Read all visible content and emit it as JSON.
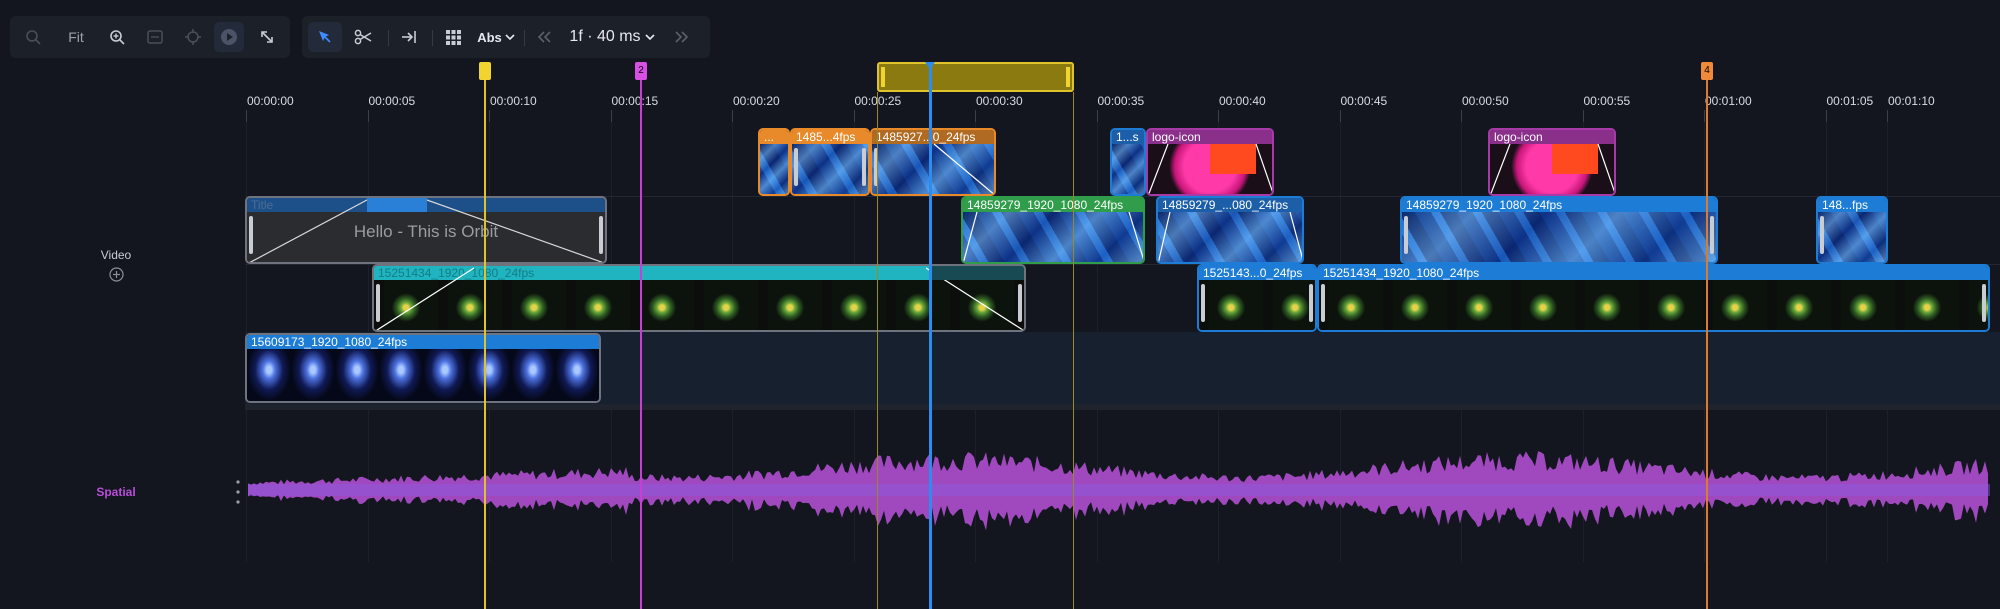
{
  "toolbar": {
    "fit_label": "Fit",
    "time_mode": "Abs",
    "frame_step": "1f · 40 ms",
    "icons": [
      "zoom-out-icon",
      "zoom-in-icon",
      "fit-selection-icon",
      "focus-icon",
      "play-range-icon",
      "expand-icon",
      "select-arrow-icon",
      "scissors-icon",
      "skip-to-end-icon",
      "grid-icon",
      "prev-frame-icon",
      "next-frame-icon"
    ]
  },
  "ruler": {
    "labels": [
      "00:00:00",
      "00:00:05",
      "00:00:10",
      "00:00:15",
      "00:00:20",
      "00:00:25",
      "00:00:30",
      "00:00:35",
      "00:00:40",
      "00:00:45",
      "00:00:50",
      "00:00:55",
      "00:01:00",
      "00:01:05",
      "00:01:10"
    ]
  },
  "markers": [
    {
      "label": "",
      "color": "#e0c22a"
    },
    {
      "label": "2",
      "color": "#c93fd6"
    },
    {
      "label": "4",
      "color": "#e07a2a"
    }
  ],
  "tracks": {
    "video_label": "Video",
    "audio_label": "Spatial",
    "audio_color": "#b84fd8"
  },
  "clips": {
    "c1": "...",
    "c2": "1485...4fps",
    "c3": "1485927...0_24fps",
    "c4": "1...s",
    "c5": "logo-icon",
    "c6": "logo-icon",
    "title": "Title",
    "title_text": "Hello - This is Orbit",
    "c7": "14859279_1920_1080_24fps",
    "c8": "14859279_...080_24fps",
    "c9": "14859279_1920_1080_24fps",
    "c10": "148...fps",
    "c11": "15251434_1920_1080_24fps",
    "c12": "1525143...0_24fps",
    "c13": "15251434_1920_1080_24fps",
    "c14": "15609173_1920_1080_24fps"
  }
}
